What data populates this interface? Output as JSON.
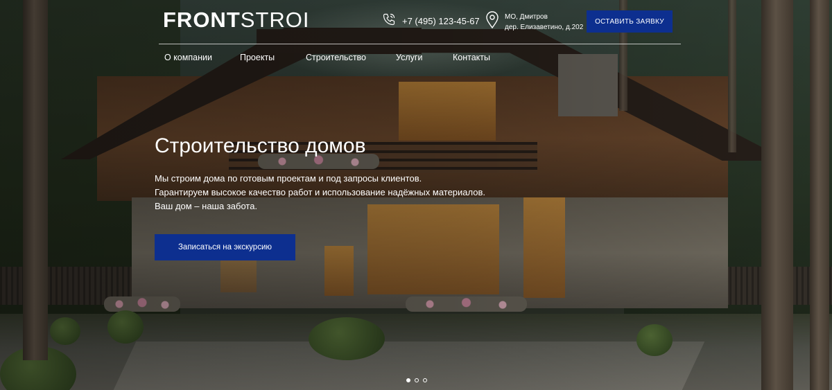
{
  "brand": {
    "logo_bold": "FRONT",
    "logo_light": "STROI"
  },
  "contact": {
    "phone": "+7 (495) 123-45-67",
    "phone_icon": "phone-icon",
    "address_line1": "МО, Дмитров",
    "address_line2": "дер. Елизаветино, д.202",
    "address_icon": "map-pin-icon"
  },
  "header": {
    "cta_label": "Оставить заявку"
  },
  "nav": {
    "items": [
      {
        "label": "О компании"
      },
      {
        "label": "Проекты"
      },
      {
        "label": "Строительство"
      },
      {
        "label": "Услуги"
      },
      {
        "label": "Контакты"
      }
    ]
  },
  "hero": {
    "title": "Строительство домов",
    "lines": [
      "Мы строим дома по готовым проектам и под запросы клиентов.",
      "Гарантируем высокое качество работ и использование надёжных материалов.",
      "Ваш дом – наша забота."
    ],
    "cta_label": "Записаться на экскурсию",
    "background": "house-in-forest-photo"
  },
  "slider": {
    "count": 3,
    "active_index": 1
  },
  "colors": {
    "accent": "#0d2f8f",
    "text": "#ffffff"
  }
}
